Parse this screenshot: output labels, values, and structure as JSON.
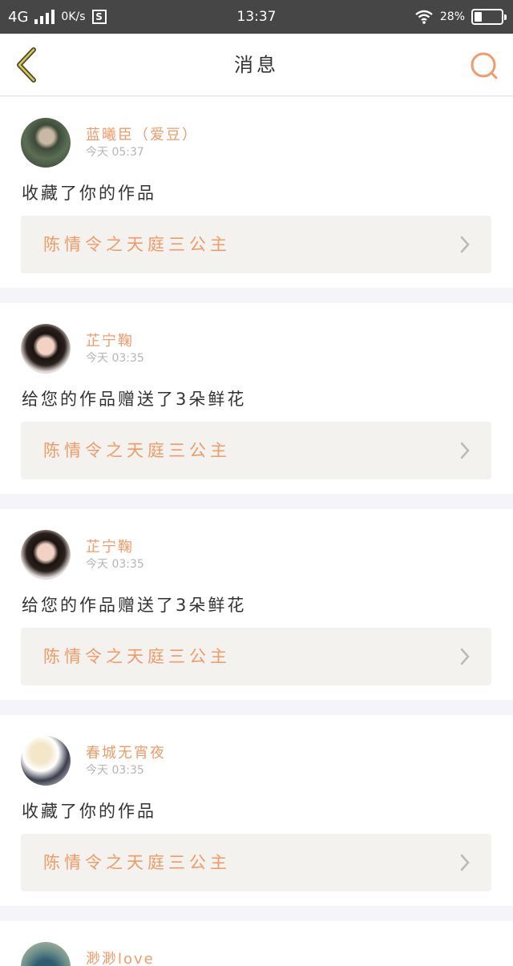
{
  "status_bar": {
    "network": "4G",
    "speed": "0K/s",
    "s_badge": "S",
    "time": "13:37",
    "battery_text": "28%",
    "battery_level": 0.28
  },
  "nav": {
    "title": "消息",
    "back_icon": "chevron-left-icon",
    "search_icon": "search-icon",
    "accent_color": "#ef9b6a"
  },
  "messages": [
    {
      "name": "蓝曦臣（爱豆）",
      "time": "今天 05:37",
      "text": "收藏了你的作品",
      "work": "陈情令之天庭三公主"
    },
    {
      "name": "芷宁鞠",
      "time": "今天 03:35",
      "text": "给您的作品赠送了3朵鲜花",
      "work": "陈情令之天庭三公主"
    },
    {
      "name": "芷宁鞠",
      "time": "今天 03:35",
      "text": "给您的作品赠送了3朵鲜花",
      "work": "陈情令之天庭三公主"
    },
    {
      "name": "春城无宵夜",
      "time": "今天 03:35",
      "text": "收藏了你的作品",
      "work": "陈情令之天庭三公主"
    },
    {
      "name": "渺渺love"
    }
  ]
}
